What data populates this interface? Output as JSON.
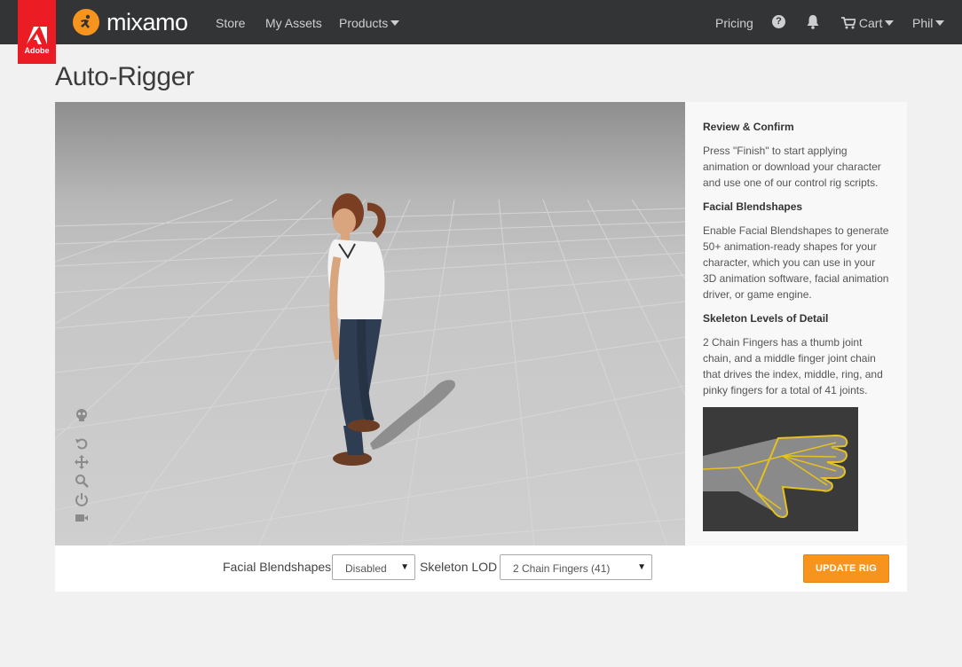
{
  "brand": {
    "adobe_label": "Adobe",
    "app_name": "mixamo",
    "accent": "#f7941d",
    "adobe_red": "#eb1c24"
  },
  "nav": {
    "store": "Store",
    "my_assets": "My Assets",
    "products": "Products",
    "pricing": "Pricing",
    "help_glyph": "?",
    "cart": "Cart",
    "user": "Phil"
  },
  "page": {
    "title": "Auto-Rigger"
  },
  "viewport_tools": [
    "skeleton-icon",
    "undo-icon",
    "move-icon",
    "zoom-icon",
    "power-icon",
    "camera-icon"
  ],
  "sidebar": {
    "sections": [
      {
        "heading": "Review & Confirm",
        "text": "Press \"Finish\" to start applying animation or download your character and use one of our control rig scripts."
      },
      {
        "heading": "Facial Blendshapes",
        "text": "Enable Facial Blendshapes to generate 50+ animation-ready shapes for your character, which you can use in your 3D animation software, facial animation driver, or game engine."
      },
      {
        "heading": "Skeleton Levels of Detail",
        "text": "2 Chain Fingers has a thumb joint chain, and a middle finger joint chain that drives the index, middle, ring, and pinky fingers for a total of 41 joints."
      }
    ]
  },
  "controls": {
    "facial_label": "Facial Blendshapes",
    "facial_value": "Disabled",
    "lod_label": "Skeleton LOD",
    "lod_value": "2 Chain Fingers (41)",
    "update_button": "UPDATE RIG"
  }
}
